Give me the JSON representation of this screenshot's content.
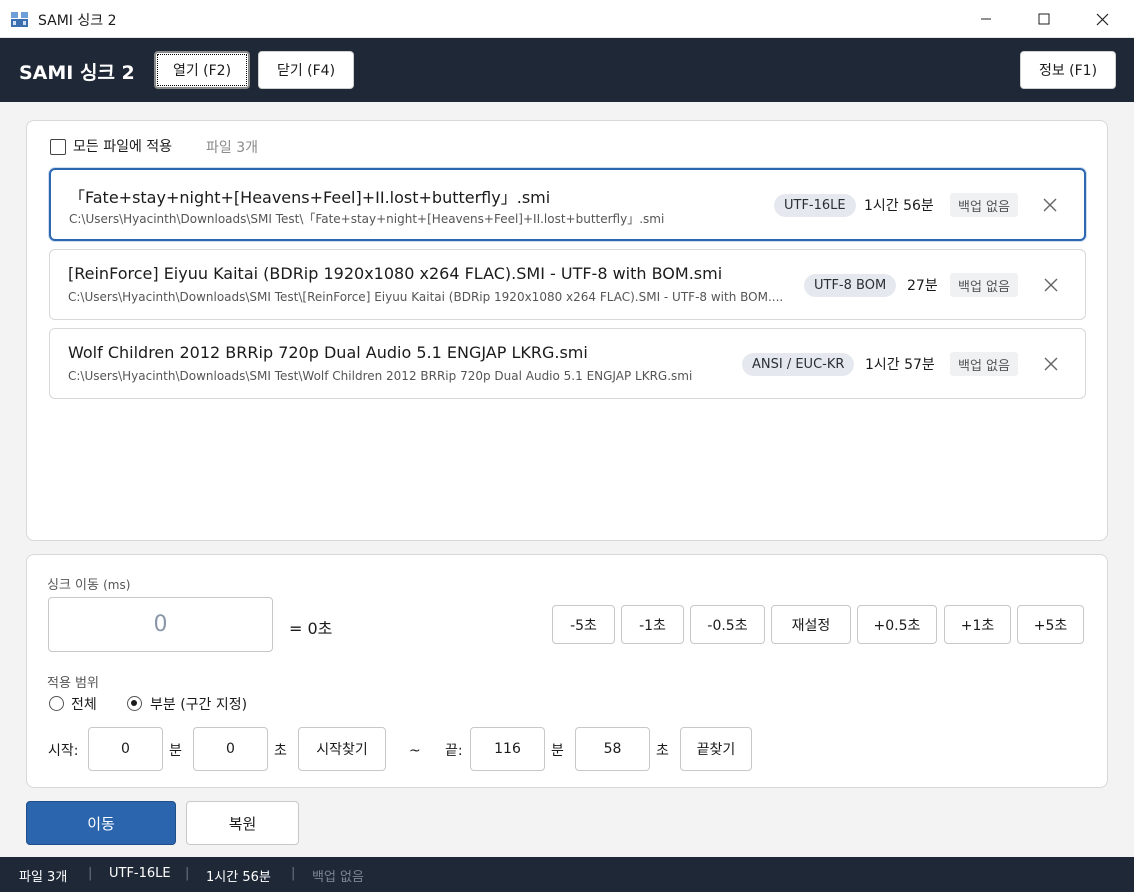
{
  "window": {
    "title": "SAMI 싱크 2"
  },
  "header": {
    "brand": "SAMI 싱크 2",
    "open_label": "열기 (F2)",
    "close_label": "닫기 (F4)",
    "info_label": "정보 (F1)"
  },
  "files": {
    "apply_all_label": "모든 파일에 적용",
    "apply_all_checked": false,
    "count_label": "파일 3개",
    "items": [
      {
        "name": "「Fate+stay+night+[Heavens+Feel]+II.lost+butterfly」.smi",
        "path": "C:\\Users\\Hyacinth\\Downloads\\SMI Test\\「Fate+stay+night+[Heavens+Feel]+II.lost+butterfly」.smi",
        "encoding": "UTF-16LE",
        "duration": "1시간 56분",
        "backup": "백업 없음",
        "selected": true
      },
      {
        "name": "[ReinForce] Eiyuu Kaitai (BDRip 1920x1080 x264 FLAC).SMI - UTF-8 with BOM.smi",
        "path": "C:\\Users\\Hyacinth\\Downloads\\SMI Test\\[ReinForce] Eiyuu Kaitai (BDRip 1920x1080 x264 FLAC).SMI - UTF-8 with BOM....",
        "encoding": "UTF-8 BOM",
        "duration": "27분",
        "backup": "백업 없음",
        "selected": false
      },
      {
        "name": "Wolf Children 2012 BRRip 720p Dual Audio 5.1 ENGJAP LKRG.smi",
        "path": "C:\\Users\\Hyacinth\\Downloads\\SMI Test\\Wolf Children 2012 BRRip 720p Dual Audio 5.1 ENGJAP LKRG.smi",
        "encoding": "ANSI / EUC-KR",
        "duration": "1시간 57분",
        "backup": "백업 없음",
        "selected": false
      }
    ]
  },
  "sync": {
    "shift_label": "싱크 이동",
    "shift_unit": "(ms)",
    "shift_value": "0",
    "equals_text": "= 0초",
    "buttons": [
      "-5초",
      "-1초",
      "-0.5초",
      "재설정",
      "+0.5초",
      "+1초",
      "+5초"
    ],
    "range_label": "적용 범위",
    "range_all": "전체",
    "range_partial": "부분 (구간 지정)",
    "range_selected": "partial",
    "start_label": "시작:",
    "start_min": "0",
    "min_unit": "분",
    "start_sec": "0",
    "sec_unit": "초",
    "find_start": "시작찾기",
    "tilde": "~",
    "end_label": "끝:",
    "end_min": "116",
    "end_sec": "58",
    "find_end": "끝찾기"
  },
  "actions": {
    "move_label": "이동",
    "restore_label": "복원"
  },
  "status": {
    "files": "파일 3개",
    "encoding": "UTF-16LE",
    "duration": "1시간 56분",
    "backup": "백업 없음"
  },
  "colors": {
    "header_bg": "#1f2837",
    "accent": "#2a65ad",
    "selected_border": "#2d67b0"
  }
}
